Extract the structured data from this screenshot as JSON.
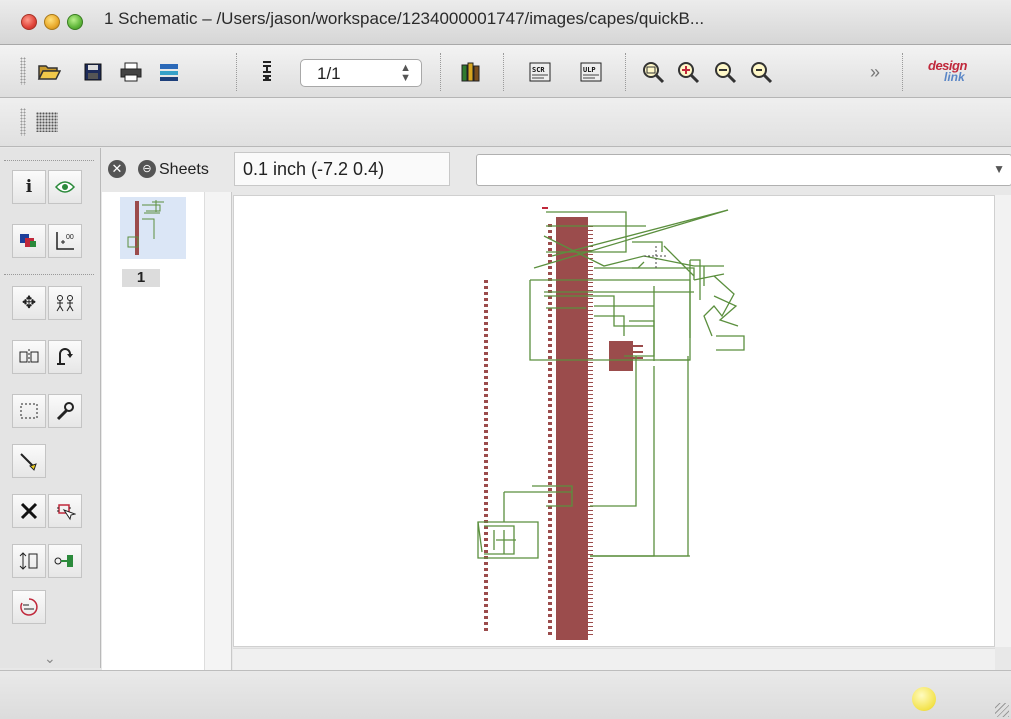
{
  "window": {
    "title": "1 Schematic – /Users/jason/workspace/1234000001747/images/capes/quickB..."
  },
  "toolbar": {
    "page_selector_value": "1/1",
    "more_label": "»",
    "brand_top": "design",
    "brand_bottom": "link"
  },
  "sheets": {
    "header_label": "Sheets",
    "items": [
      {
        "label": "1"
      }
    ]
  },
  "command_bar": {
    "grid_readout": "0.1 inch (-7.2 0.4)",
    "command_value": ""
  },
  "colors": {
    "net": "#5b8f3e",
    "part": "#9b4c4c",
    "accent": "#c0283b"
  }
}
